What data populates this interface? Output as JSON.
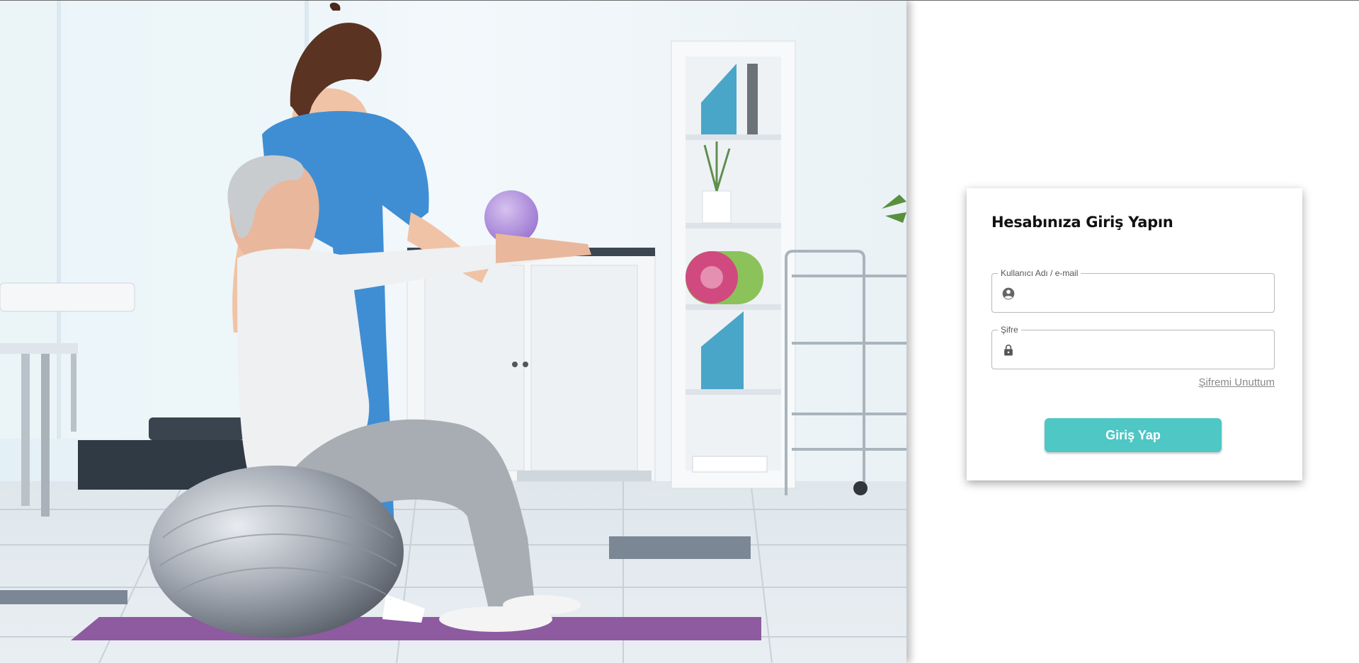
{
  "login": {
    "title": "Hesabınıza Giriş Yapın",
    "username_label": "Kullanıcı Adı / e-mail",
    "username_value": "",
    "username_icon": "account-circle-icon",
    "password_label": "Şifre",
    "password_value": "",
    "password_icon": "lock-icon",
    "forgot_label": "Şifremi Unuttum",
    "submit_label": "Giriş Yap"
  },
  "hero": {
    "image": "physiotherapy-clinic-photo"
  },
  "colors": {
    "accent": "#4ec7c5",
    "field_border": "#b9b9b9",
    "link": "#8a8a8a",
    "title": "#111111"
  }
}
